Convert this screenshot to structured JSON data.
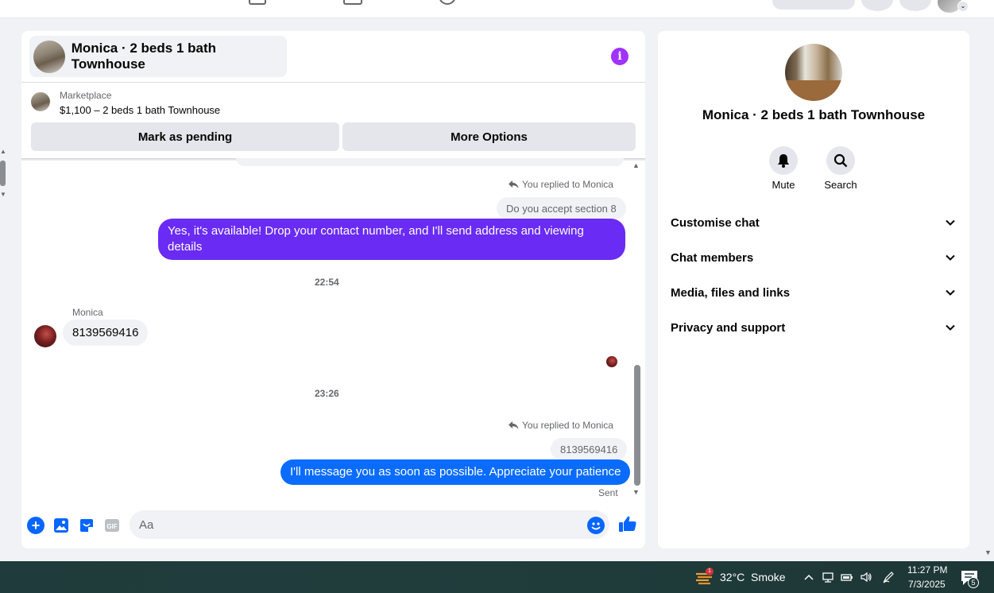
{
  "chat": {
    "title": "Monica · 2 beds 1 bath Townhouse",
    "marketplace_label": "Marketplace",
    "listing": "$1,100 – 2 beds 1 bath Townhouse",
    "mark_pending_label": "Mark as pending",
    "more_options_label": "More Options",
    "messages": {
      "reply_note_1": "You replied to Monica",
      "quoted_1": "Do you accept section 8",
      "out_1": "Yes, it's available! Drop your contact number, and I'll send address and viewing details",
      "time_1": "22:54",
      "sender": "Monica",
      "in_1": "8139569416",
      "time_2": "23:26",
      "reply_note_2": "You replied to Monica",
      "quoted_2": "8139569416",
      "out_2": "I'll message you as soon as possible. Appreciate your patience",
      "status": "Sent"
    },
    "composer": {
      "placeholder": "Aa"
    }
  },
  "side": {
    "name": "Monica · 2 beds 1 bath Townhouse",
    "mute_label": "Mute",
    "search_label": "Search",
    "sections": [
      "Customise chat",
      "Chat members",
      "Media, files and links",
      "Privacy and support"
    ]
  },
  "taskbar": {
    "weather_badge": "1",
    "temperature": "32°C",
    "condition": "Smoke",
    "time": "11:27 PM",
    "date": "7/3/2025",
    "notification_count": "5"
  },
  "colors": {
    "accent_blue": "#0866ff",
    "bubble_purple": "#6a2bf5",
    "bubble_blue": "#0a6cff",
    "info_purple": "#a033ff"
  }
}
